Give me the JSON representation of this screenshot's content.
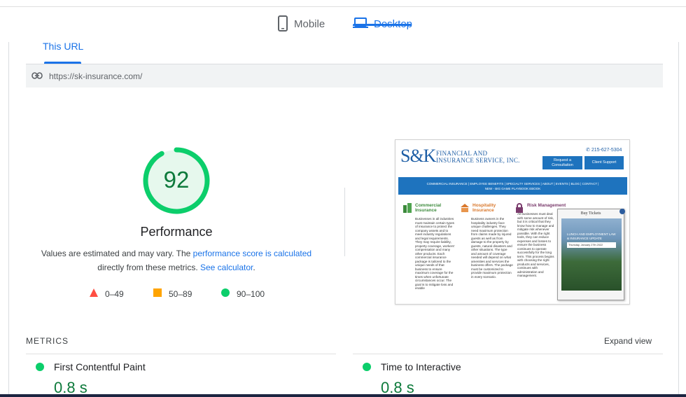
{
  "device_tabs": [
    {
      "label": "Mobile",
      "icon": "smartphone-icon",
      "active": false
    },
    {
      "label": "Desktop",
      "icon": "laptop-icon",
      "active": true
    }
  ],
  "url_tab": {
    "label": "This URL"
  },
  "url": {
    "icon": "link-icon",
    "value": "https://sk-insurance.com/"
  },
  "score": {
    "value": "92",
    "fraction": 0.92,
    "title": "Performance",
    "desc_prefix": "Values are estimated and may vary. The ",
    "desc_link1": "performance score is calculated",
    "desc_middle": "directly from these metrics. ",
    "desc_link2": "See calculator",
    "desc_suffix": ".",
    "color": "#0cce6b"
  },
  "legend": [
    {
      "range": "0–49",
      "shape": "triangle",
      "color": "#ff4e42"
    },
    {
      "range": "50–89",
      "shape": "square",
      "color": "#ffa400"
    },
    {
      "range": "90–100",
      "shape": "circle",
      "color": "#0cce6b"
    }
  ],
  "screenshot": {
    "logo_mark": "S&K",
    "logo_line1": "Financial and",
    "logo_line2": "Insurance Service, Inc.",
    "phone": "215-627-5304",
    "btn_request": "Request a Consultation",
    "btn_client": "Client Support",
    "nav_line1": "COMMERCIAL INSURANCE | EMPLOYEE BENEFITS | SPECIALTY SERVICES | ABOUT | EVENTS | BLOG | CONTACT |",
    "nav_line2": "NEW - BIG GAME PLAYBOOK EBOOK",
    "col1_title": "Commercial Insurance",
    "col1_text": "Businesses in all industries must maintain certain types of insurance to protect the company assets and to meet industry regulations and legal requirements. They may require liability, property coverage, workers' compensation and many other products. Each commercial insurance package is tailored to the unique needs of that business to ensure maximum coverage for the times when unfortunate circumstances occur. The goal is to mitigate loss and enable",
    "col2_title": "Hospitality Insurance",
    "col2_text": "Business owners in the hospitality industry face unique challenges. They need maximum protection from claims made by injured guests as well as from damage to the property by guests, natural disasters and other situations. The type and amount of coverage needed will depend on what amenities and services the business offers. The package must be customized to provide maximum protection in every scenario.",
    "col3_title": "Risk Management",
    "col3_text": "All businesses must deal with some amount of risk, but it is critical that they know how to manage and mitigate risk whenever possible. With the right tools, they can reduce expenses and losses to ensure the business continues to operate successfully for the long term. This process begins with choosing the right products and services, continues with administration and management.",
    "ad_title": "Buy Tickets",
    "ad_date": "Thursday, January 27th 2022",
    "ad_caption": "LUNCH AND EMPLOYMENT LAW & INSURANCE UPDATE"
  },
  "metrics": {
    "title": "METRICS",
    "expand_label": "Expand view",
    "items": [
      {
        "label": "First Contentful Paint",
        "value": "0.8 s",
        "status_color": "#0cce6b"
      },
      {
        "label": "Time to Interactive",
        "value": "0.8 s",
        "status_color": "#0cce6b"
      }
    ]
  }
}
